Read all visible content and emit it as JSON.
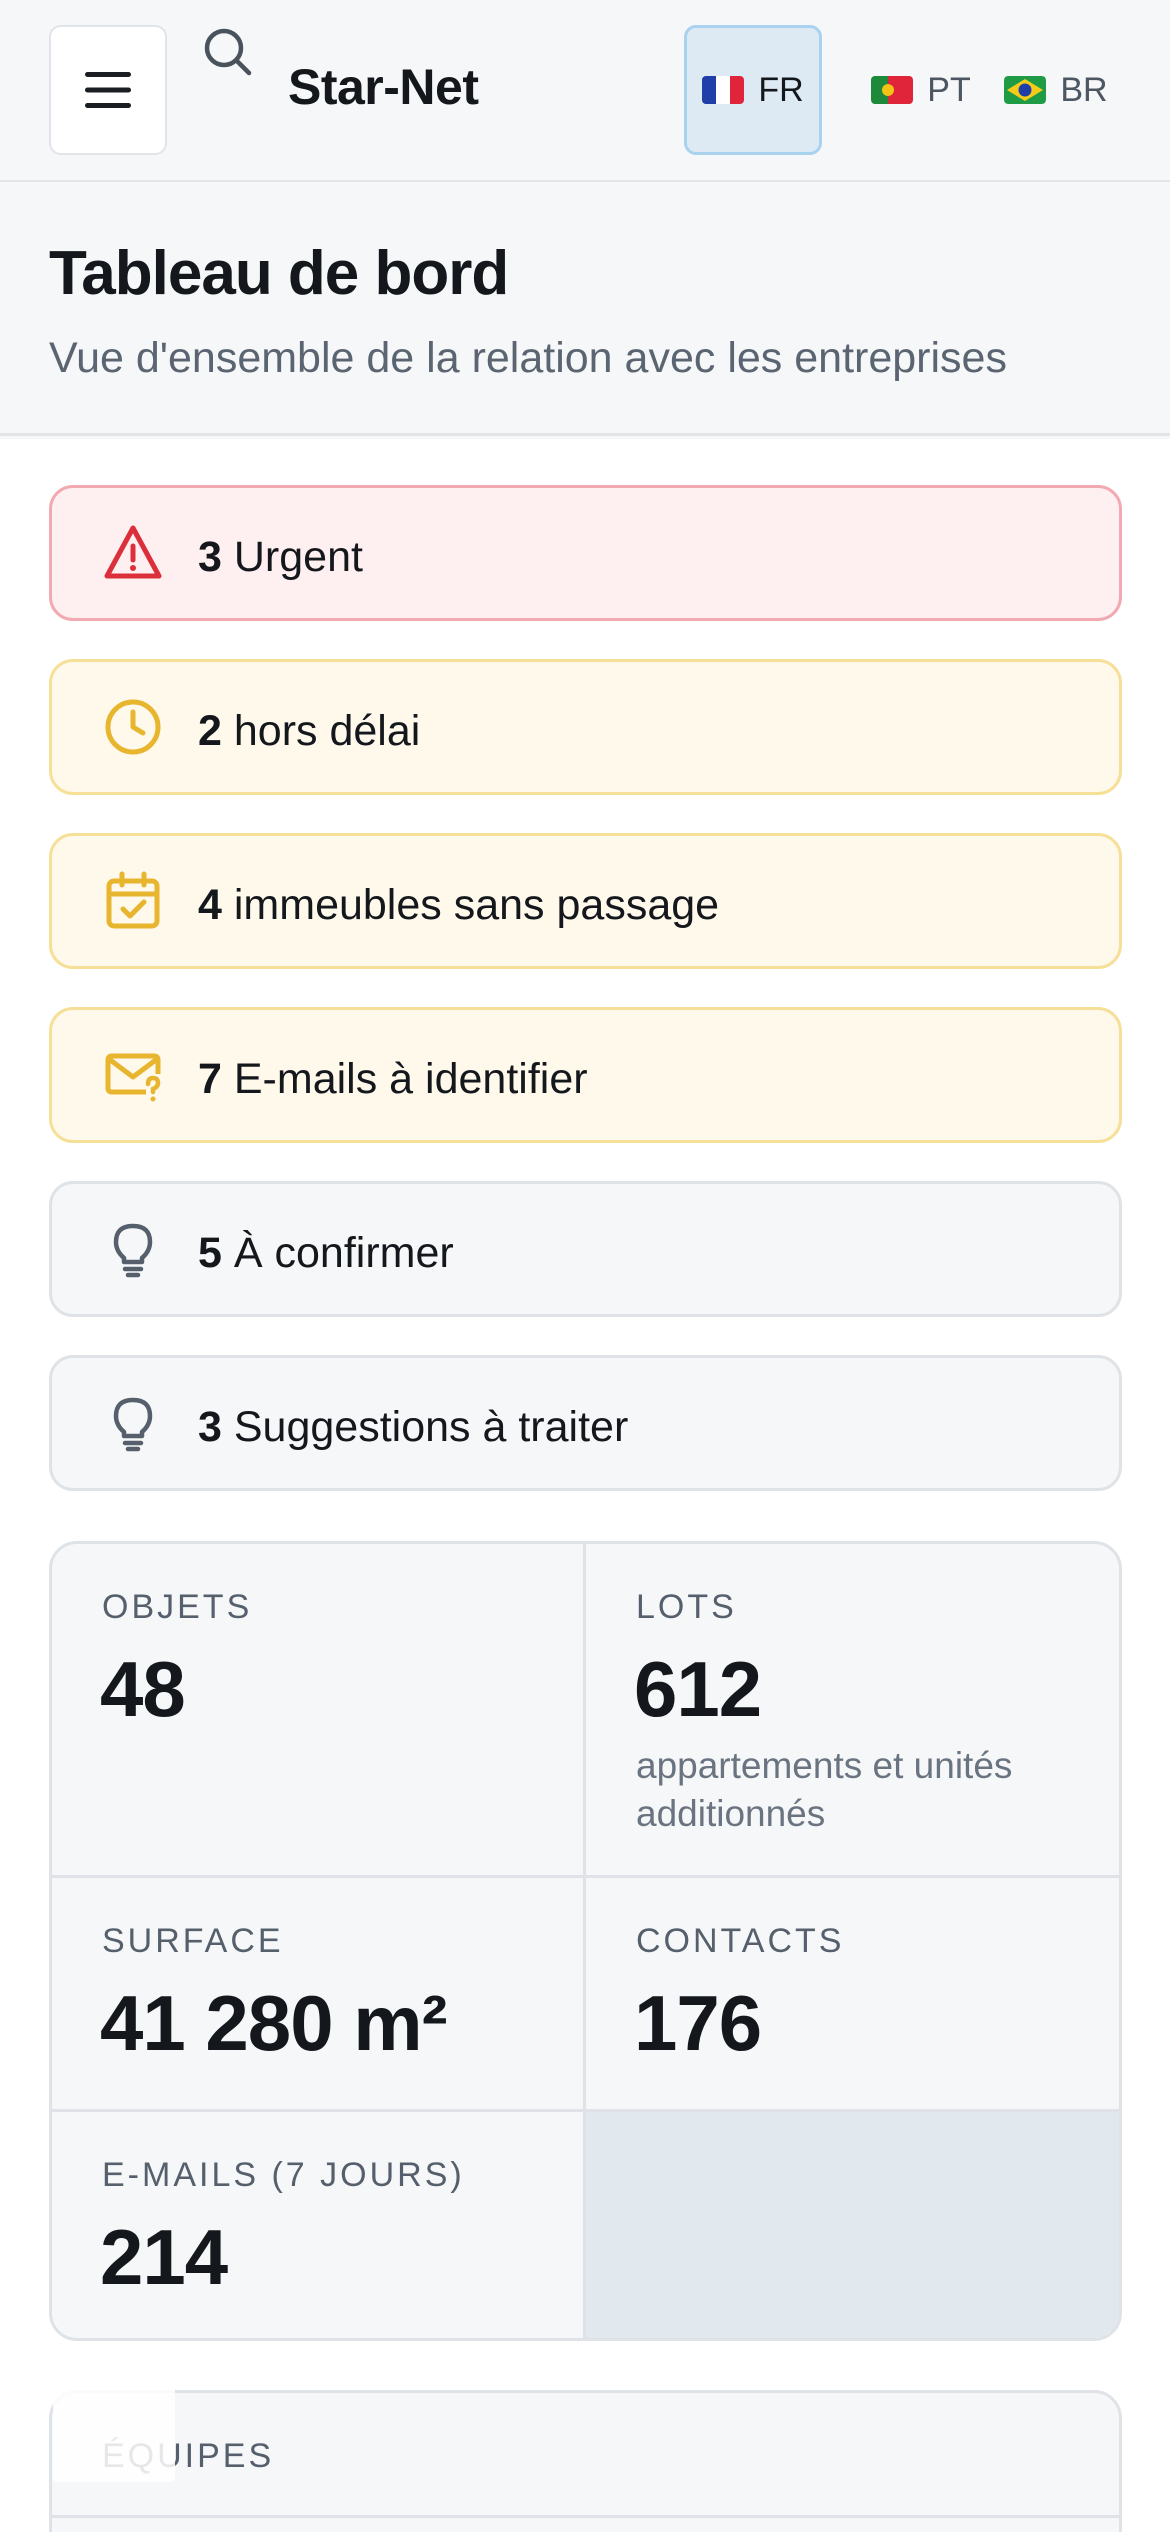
{
  "header": {
    "app_name": "Star-Net",
    "languages": [
      {
        "code": "FR",
        "active": true
      },
      {
        "code": "PT",
        "active": false
      },
      {
        "code": "BR",
        "active": false
      }
    ]
  },
  "page": {
    "title": "Tableau de bord",
    "subtitle": "Vue d'ensemble de la relation avec les entreprises"
  },
  "alerts": [
    {
      "count": "3",
      "label": "Urgent",
      "icon": "warning-triangle-icon",
      "tone": "red"
    },
    {
      "count": "2",
      "label": "hors délai",
      "icon": "clock-icon",
      "tone": "yellow"
    },
    {
      "count": "4",
      "label": "immeubles sans passage",
      "icon": "calendar-check-icon",
      "tone": "yellow"
    },
    {
      "count": "7",
      "label": "E-mails à identifier",
      "icon": "mail-question-icon",
      "tone": "yellow"
    },
    {
      "count": "5",
      "label": "À confirmer",
      "icon": "lightbulb-icon",
      "tone": "gray"
    },
    {
      "count": "3",
      "label": "Suggestions à traiter",
      "icon": "lightbulb-icon",
      "tone": "gray"
    }
  ],
  "stats": {
    "objets": {
      "label": "OBJETS",
      "value": "48"
    },
    "lots": {
      "label": "LOTS",
      "value": "612",
      "note": "appartements et unités additionnés"
    },
    "surface": {
      "label": "SURFACE",
      "value": "41 280 m²"
    },
    "contacts": {
      "label": "CONTACTS",
      "value": "176"
    },
    "emails": {
      "label": "E-MAILS (7 JOURS)",
      "value": "214"
    }
  },
  "teams": {
    "label": "ÉQUIPES"
  },
  "colors": {
    "red_alert_bg": "#feeff0",
    "red_alert_border": "#f2a9b1",
    "red_icon": "#dc2f3c",
    "yellow_alert_bg": "#fff9ec",
    "yellow_alert_border": "#f6df96",
    "yellow_icon": "#e8b52e",
    "gray_icon": "#55606c",
    "active_lang_bg": "#dde9f3"
  }
}
